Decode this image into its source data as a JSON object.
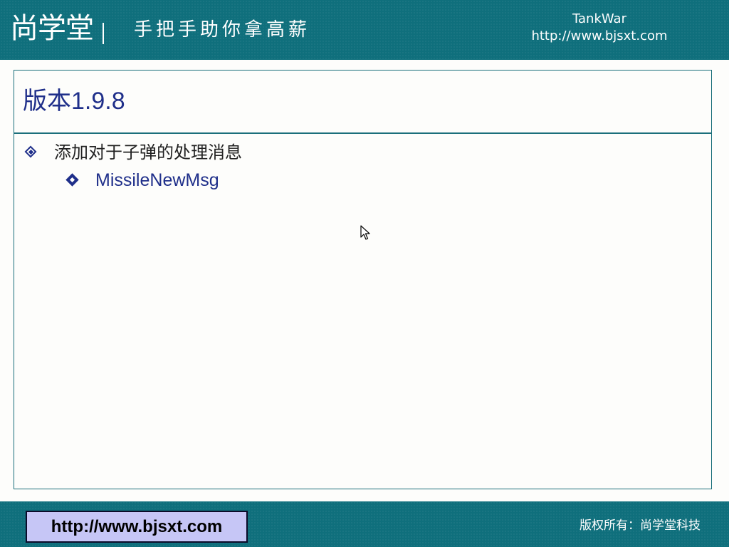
{
  "header": {
    "logo_text": "尚学堂",
    "slogan": "手把手助你拿高薪",
    "course_title": "TankWar",
    "course_url": "http://www.bjsxt.com"
  },
  "slide": {
    "title": "版本1.9.8",
    "bullets": [
      {
        "text": "添加对于子弹的处理消息",
        "icon": "hollow-diamond-bullet",
        "sub_bullets": [
          {
            "text": "MissileNewMsg",
            "icon": "filled-diamond-bullet"
          }
        ]
      }
    ]
  },
  "footer": {
    "url_button": "http://www.bjsxt.com",
    "copyright": "版权所有：尚学堂科技"
  },
  "colors": {
    "header_teal": "#0f6f7c",
    "title_blue": "#1f2f8a",
    "url_box_lavender": "#c6c6f6"
  },
  "icons": {
    "cursor": "mouse-pointer-icon"
  }
}
